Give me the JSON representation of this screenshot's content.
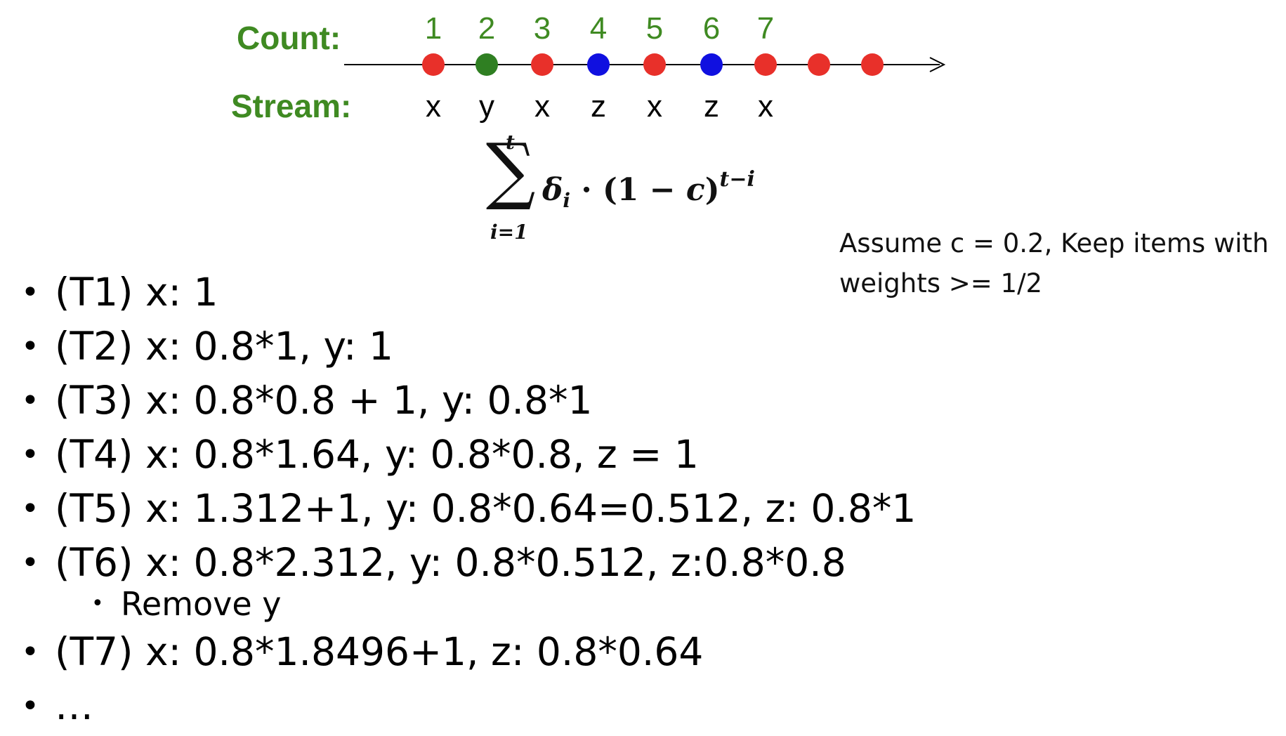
{
  "diagram": {
    "count_label": "Count:",
    "stream_label": "Stream:",
    "colors": {
      "x": "#e8302a",
      "y": "#2f7f22",
      "z": "#1010e0"
    },
    "counts": [
      "1",
      "2",
      "3",
      "4",
      "5",
      "6",
      "7"
    ],
    "stream": [
      "x",
      "y",
      "x",
      "z",
      "x",
      "z",
      "x"
    ],
    "dot_colors": [
      "x",
      "y",
      "x",
      "z",
      "x",
      "z",
      "x",
      "x",
      "x"
    ]
  },
  "formula": {
    "upper": "t",
    "lower": "i=1",
    "delta": "δ",
    "sub": "i",
    "middle": " · (",
    "one": "1",
    "minus": " − ",
    "c": "c",
    "close": ")",
    "exponent": "t−i"
  },
  "note": {
    "line1": "Assume c = 0.2, Keep items with",
    "line2": "weights >= 1/2"
  },
  "steps": [
    "(T1) x: 1",
    "(T2) x: 0.8*1, y: 1",
    "(T3) x: 0.8*0.8 + 1, y: 0.8*1",
    "(T4) x: 0.8*1.64, y: 0.8*0.8, z = 1",
    "(T5) x: 1.312+1, y: 0.8*0.64=0.512, z: 0.8*1",
    "(T6) x: 0.8*2.312, y: 0.8*0.512, z:0.8*0.8",
    "(T7) x: 0.8*1.8496+1, z: 0.8*0.64",
    "…"
  ],
  "substep": "Remove y",
  "bullet": "•"
}
